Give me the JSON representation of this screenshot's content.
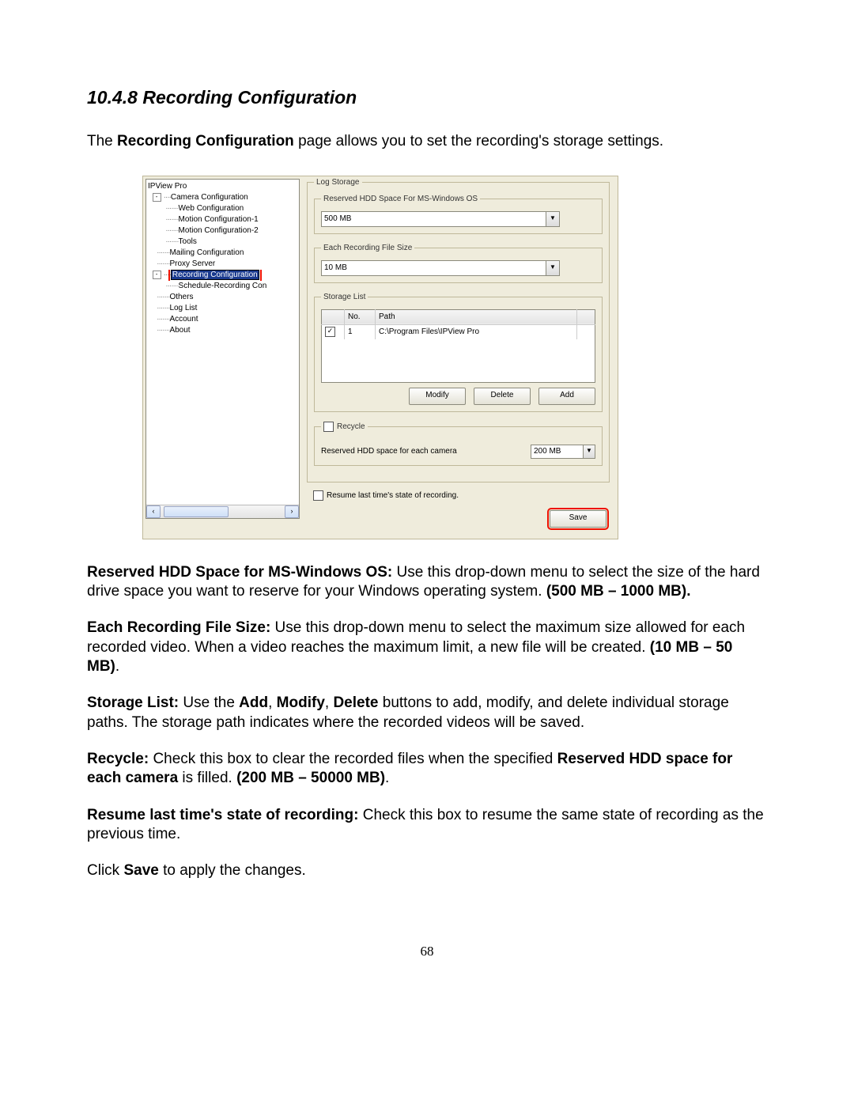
{
  "heading": "10.4.8 Recording Configuration",
  "intro_pre": "The ",
  "intro_bold": "Recording Configuration",
  "intro_post": " page allows you to set the recording's storage settings.",
  "tree": {
    "root": "IPView Pro",
    "nodes": [
      "Camera Configuration",
      "Web Configuration",
      "Motion Configuration-1",
      "Motion Configuration-2",
      "Tools",
      "Mailing Configuration",
      "Proxy Server"
    ],
    "selected": "Recording Configuration",
    "after_selected": "Schedule-Recording Con",
    "tail": [
      "Others",
      "Log List",
      "Account",
      "About"
    ]
  },
  "log_storage": {
    "group": "Log Storage",
    "reserved_group": "Reserved HDD Space For MS-Windows OS",
    "reserved_value": "500 MB",
    "filesize_group": "Each Recording File Size",
    "filesize_value": "10 MB",
    "storage_group": "Storage List",
    "col_no": "No.",
    "col_path": "Path",
    "row_no": "1",
    "row_path": "C:\\Program Files\\IPView Pro",
    "btn_modify": "Modify",
    "btn_delete": "Delete",
    "btn_add": "Add",
    "recycle_group": "Recycle",
    "recycle_label": "Reserved HDD space for each camera",
    "recycle_value": "200 MB",
    "resume_label": "Resume last time's state of recording.",
    "save": "Save"
  },
  "paras": {
    "p1_b1": "Reserved HDD Space for MS-Windows OS:",
    "p1_t1": " Use this drop-down menu to select the size of the hard drive space you want to reserve for your Windows operating system. ",
    "p1_b2": "(500 MB – 1000 MB).",
    "p2_b1": "Each Recording File Size:",
    "p2_t1": " Use this drop-down menu to select the maximum size allowed for each recorded video. When a video reaches the maximum limit, a new file will be created. ",
    "p2_b2": "(10 MB – 50 MB)",
    "p2_t2": ".",
    "p3_b1": "Storage List:",
    "p3_t1": " Use the ",
    "p3_b2": "Add",
    "p3_t2": ", ",
    "p3_b3": "Modify",
    "p3_t3": ", ",
    "p3_b4": "Delete",
    "p3_t4": " buttons to add, modify, and delete individual storage paths. The storage path indicates where the recorded videos will be saved.",
    "p4_b1": "Recycle:",
    "p4_t1": " Check this box to clear the recorded files when the specified ",
    "p4_b2": "Reserved HDD space for each camera",
    "p4_t2": " is filled. ",
    "p4_b3": "(200 MB – 50000 MB)",
    "p4_t3": ".",
    "p5_b1": "Resume last time's state of recording:",
    "p5_t1": " Check this box to resume the same state of recording as the previous time.",
    "p6_t1": "Click ",
    "p6_b1": "Save",
    "p6_t2": " to apply the changes."
  },
  "pagenum": "68"
}
